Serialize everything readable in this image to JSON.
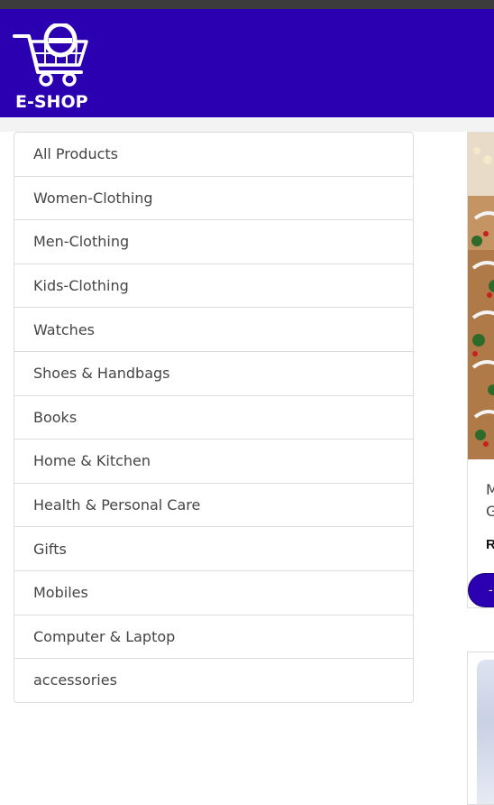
{
  "header": {
    "logo_text": "E-SHOP",
    "brand_color": "#2a00b0"
  },
  "categories": [
    "All Products",
    "Women-Clothing",
    "Men-Clothing",
    "Kids-Clothing",
    "Watches",
    "Shoes & Handbags",
    "Books",
    "Home & Kitchen",
    "Health & Personal Care",
    "Gifts",
    "Mobiles",
    "Computer & Laptop",
    "accessories"
  ],
  "product_card_1": {
    "title_line1": "M",
    "title_line2": "G",
    "price": "R",
    "button_label": "-"
  }
}
